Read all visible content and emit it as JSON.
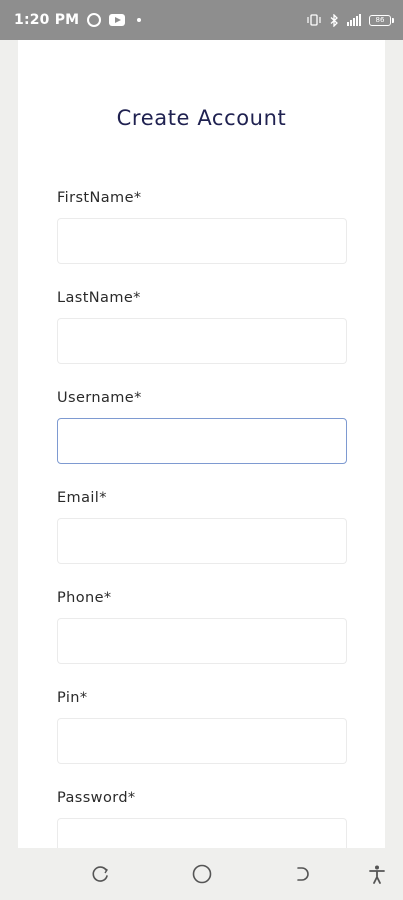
{
  "status_bar": {
    "time": "1:20 PM",
    "left_icons": [
      "whatsapp-icon",
      "youtube-icon",
      "notification-dot-icon"
    ],
    "right_icons": [
      "vibrate-icon",
      "bluetooth-icon",
      "signal-icon",
      "battery-icon"
    ],
    "battery_text": "86"
  },
  "form": {
    "title": "Create Account",
    "fields": [
      {
        "label": "FirstName*",
        "value": "",
        "focused": false
      },
      {
        "label": "LastName*",
        "value": "",
        "focused": false
      },
      {
        "label": "Username*",
        "value": "",
        "focused": true
      },
      {
        "label": "Email*",
        "value": "",
        "focused": false
      },
      {
        "label": "Phone*",
        "value": "",
        "focused": false
      },
      {
        "label": "Pin*",
        "value": "",
        "focused": false
      },
      {
        "label": "Password*",
        "value": "",
        "focused": false
      }
    ]
  },
  "nav_bar": {
    "buttons": [
      "recent-apps-icon",
      "home-icon",
      "back-icon",
      "accessibility-icon"
    ]
  },
  "colors": {
    "title": "#1f2150",
    "focus_border": "#7e9ad1",
    "status_bar_bg": "#8e8e8e",
    "page_bg": "#efefed"
  }
}
